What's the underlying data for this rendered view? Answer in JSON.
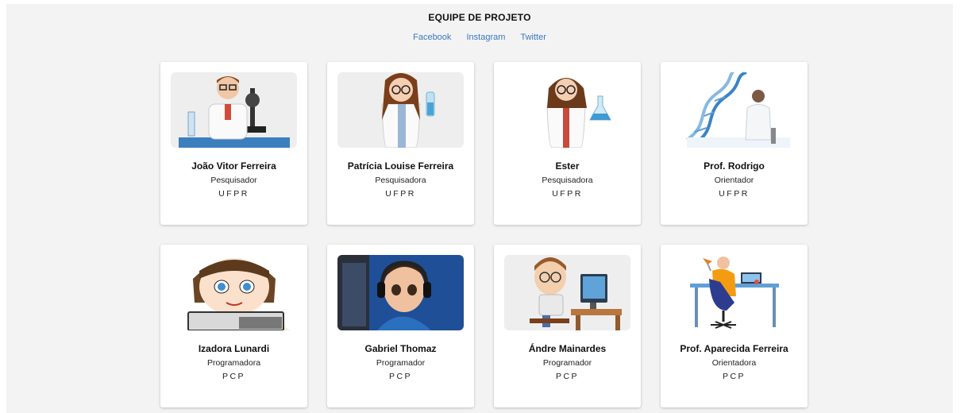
{
  "header": {
    "title": "EQUIPE DE PROJETO",
    "links": [
      "Facebook",
      "Instagram",
      "Twitter"
    ]
  },
  "members": [
    {
      "name": "João Vitor Ferreira",
      "role": "Pesquisador",
      "inst": "UFPR",
      "icon": "scientist-microscope-icon"
    },
    {
      "name": "Patrícia Louise Ferreira",
      "role": "Pesquisadora",
      "inst": "UFPR",
      "icon": "scientist-flask-icon"
    },
    {
      "name": "Ester",
      "role": "Pesquisadora",
      "inst": "UFPR",
      "icon": "scientist-flask-icon"
    },
    {
      "name": "Prof. Rodrigo",
      "role": "Orientador",
      "inst": "UFPR",
      "icon": "dna-scientist-icon"
    },
    {
      "name": "Izadora Lunardi",
      "role": "Programadora",
      "inst": "PCP",
      "icon": "girl-laptop-icon"
    },
    {
      "name": "Gabriel Thomaz",
      "role": "Programador",
      "inst": "PCP",
      "icon": "boy-headset-icon"
    },
    {
      "name": "Ándre Mainardes",
      "role": "Programador",
      "inst": "PCP",
      "icon": "boy-computer-icon"
    },
    {
      "name": "Prof. Aparecida Ferreira",
      "role": "Orientadora",
      "inst": "PCP",
      "icon": "person-desk-icon"
    }
  ]
}
